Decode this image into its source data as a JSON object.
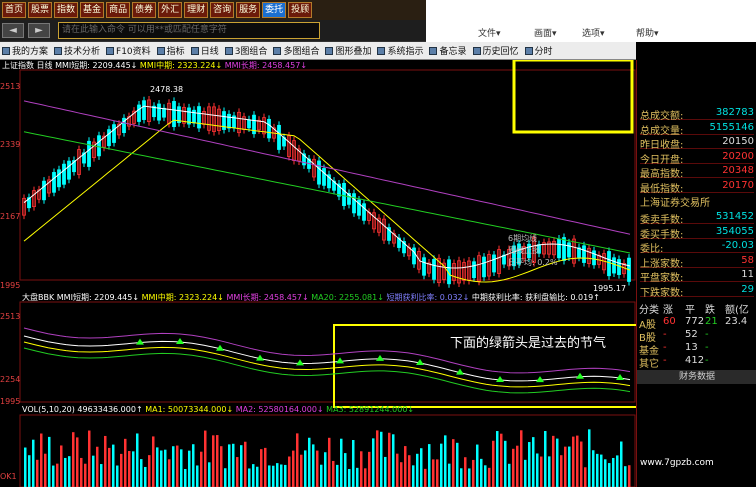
{
  "menu": {
    "items": [
      "首页",
      "股票",
      "指数",
      "基金",
      "商品",
      "债券",
      "外汇",
      "理财",
      "咨询",
      "服务",
      "委托",
      "投顾"
    ],
    "active": 10
  },
  "search": {
    "placeholder": "请在此输入命令  可以用**或匹配任意字符"
  },
  "window": {
    "file": "文件▾",
    "help": "帮助▾",
    "home": "画面▾",
    "option": "选项▾",
    "nav_back": "◄",
    "nav_fwd": "►"
  },
  "toolbar": {
    "items": [
      "我的方案",
      "技术分析",
      "F10资料",
      "指标",
      "日线",
      "3图组合",
      "多图组合",
      "图形叠加",
      "系统指示",
      "备忘录",
      "历史回忆",
      "分时"
    ]
  },
  "chart": {
    "top_legend": {
      "title": "上证指数 日线",
      "mmi_short": "MMI短期: 2209.445↓",
      "mmi_mid": "MMI中期: 2323.224↓",
      "mmi_long": "MMI长期: 2458.457↓"
    },
    "peak_label": "2478.38",
    "low_label": "1995.17",
    "y_top": [
      "2513",
      "2339",
      "2167",
      "1995"
    ],
    "mid_legend": {
      "title": "大盘BBK",
      "mmi_short": "MMI短期: 2209.445↓",
      "mmi_mid": "MMI中期: 2323.224↓",
      "mmi_long": "MMI长期: 2458.457↓",
      "ma20": "MA20: 2255.081↓",
      "ratio": "短期获利比率: 0.032↓",
      "mid_ratio": "中期获利比率: 获利盘输比: 0.019↑"
    },
    "y_mid": [
      "2513",
      "2254",
      "1995"
    ],
    "banner": "下面的绿箭头是过去的节气",
    "ann1": "6期均线",
    "ann2": "周线止损",
    "ann3": "日平均:  0.2%",
    "vol_legend": {
      "title": "VOL(5,10,20)",
      "v": "49633436.000↑",
      "ma1": "MA1: 50073344.000↓",
      "ma2": "MA2: 52580164.000↓",
      "ma3": "MA3: 52891244.000↓"
    },
    "y_vol": [
      "OK1"
    ],
    "colors": {
      "up": "#ff3232",
      "down": "#00ffff",
      "ma_white": "#ffffff",
      "ma_yellow": "#ffff00",
      "ma_green": "#22cc22",
      "ma_purple": "#b040c0",
      "banner_box": "#ffff00"
    }
  },
  "panel": {
    "rows": [
      {
        "label": "总成交额:",
        "value": "382783",
        "color": "#00e0e0"
      },
      {
        "label": "总成交量:",
        "value": "5155146",
        "color": "#00e0e0"
      },
      {
        "label": "昨日收盘:",
        "value": "20150",
        "color": "#dddddd"
      },
      {
        "label": "今日开盘:",
        "value": "20200",
        "color": "#ff3232"
      },
      {
        "label": "最高指数:",
        "value": "20348",
        "color": "#ff3232"
      },
      {
        "label": "最低指数:",
        "value": "20170",
        "color": "#ff3232"
      }
    ],
    "exchange": "上海证券交易所",
    "rows2": [
      {
        "label": "委卖手数:",
        "value": "531452",
        "color": "#00e0e0"
      },
      {
        "label": "委买手数:",
        "value": "354055",
        "color": "#00e0e0"
      },
      {
        "label": "委比:",
        "value": "-20.03",
        "color": "#00e0e0"
      },
      {
        "label": "上涨家数:",
        "value": "58",
        "color": "#ff3232"
      },
      {
        "label": "平盘家数:",
        "value": "11",
        "color": "#dddddd"
      },
      {
        "label": "下跌家数:",
        "value": "29",
        "color": "#00e0e0"
      }
    ],
    "table": {
      "headers": [
        "分类",
        "涨",
        "平",
        "跌",
        "额(亿"
      ],
      "rows": [
        [
          "A股",
          "60",
          "772",
          "21",
          "23.4"
        ],
        [
          "B股",
          "-",
          "52",
          "-",
          ""
        ],
        [
          "基金",
          "-",
          "13",
          "-",
          ""
        ],
        [
          "其它",
          "-",
          "412",
          "-",
          ""
        ]
      ]
    },
    "footer": "财务数据"
  },
  "watermark": "www.7gpzb.com"
}
